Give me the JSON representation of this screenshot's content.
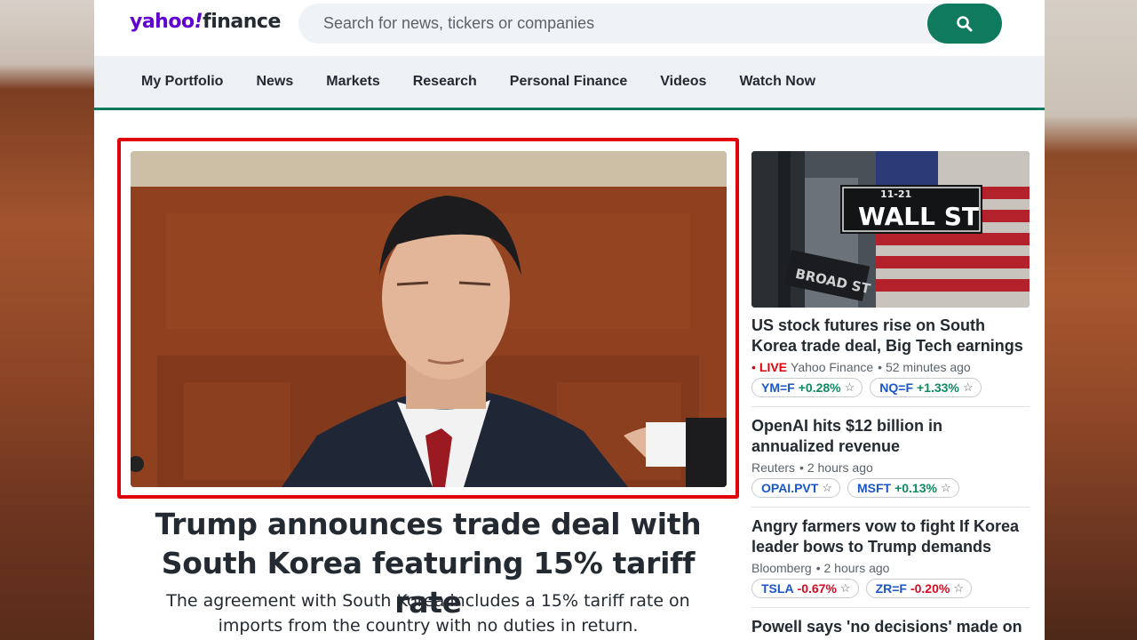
{
  "header": {
    "logo_yahoo": "yahoo",
    "logo_bang": "!",
    "logo_finance": "finance",
    "search_placeholder": "Search for news, tickers or companies"
  },
  "nav": {
    "items": [
      "My Portfolio",
      "News",
      "Markets",
      "Research",
      "Personal Finance",
      "Videos",
      "Watch Now"
    ]
  },
  "hero": {
    "headline": "Trump announces trade deal with South Korea featuring 15% tariff rate",
    "summary": "The agreement with South Korea includes a 15% tariff rate on imports from the country with no duties in return."
  },
  "side_image": {
    "sign_text": "WALL ST",
    "sign_number": "11-21",
    "sign_broad": "BROAD ST"
  },
  "stories": [
    {
      "title": "US stock futures rise on South Korea trade deal, Big Tech earnings",
      "live": "LIVE",
      "source": "Yahoo Finance",
      "time": "• 52 minutes ago",
      "tickers": [
        {
          "symbol": "YM=F",
          "change": "+0.28%",
          "dir": "up"
        },
        {
          "symbol": "NQ=F",
          "change": "+1.33%",
          "dir": "up"
        }
      ]
    },
    {
      "title": "OpenAI hits $12 billion in annualized revenue",
      "source": "Reuters",
      "time": "• 2 hours ago",
      "tickers": [
        {
          "symbol": "OPAI.PVT",
          "change": "",
          "dir": "none"
        },
        {
          "symbol": "MSFT",
          "change": "+0.13%",
          "dir": "up"
        }
      ]
    },
    {
      "title": "Angry farmers vow to fight If Korea leader bows to Trump demands",
      "source": "Bloomberg",
      "time": "• 2 hours ago",
      "tickers": [
        {
          "symbol": "TSLA",
          "change": "-0.67%",
          "dir": "down"
        },
        {
          "symbol": "ZR=F",
          "change": "-0.20%",
          "dir": "down"
        }
      ]
    },
    {
      "title": "Powell says 'no decisions' made on"
    }
  ],
  "colors": {
    "brand_purple": "#6001d2",
    "brand_green": "#0f7a5e",
    "highlight_red": "#e0000a",
    "up_green": "#0e8a5f",
    "down_red": "#d60a22"
  }
}
